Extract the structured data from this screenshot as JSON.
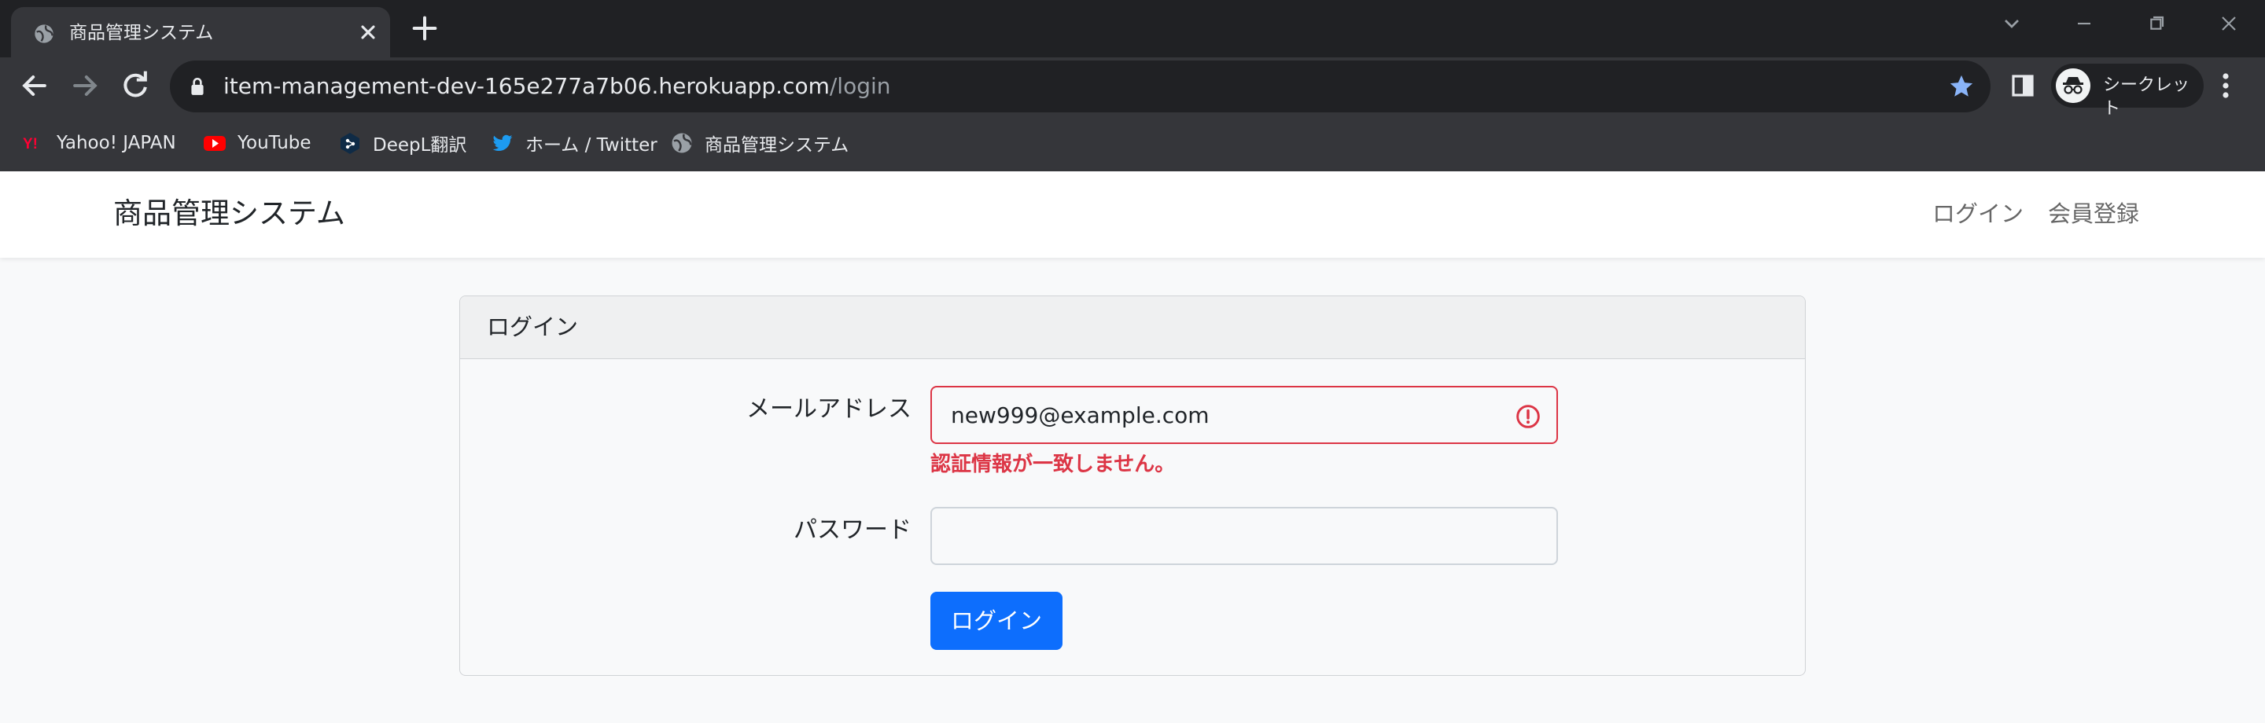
{
  "browser": {
    "tab": {
      "title": "商品管理システム",
      "favicon": "globe-icon"
    },
    "address_bar": {
      "host": "item-management-dev-165e277a7b06.herokuapp.com",
      "path": "/login"
    },
    "profile": {
      "label": "シークレット",
      "icon": "incognito-icon"
    },
    "bookmarks": [
      {
        "label": "Yahoo! JAPAN",
        "icon": "yahoo-icon"
      },
      {
        "label": "YouTube",
        "icon": "youtube-icon"
      },
      {
        "label": "DeepL翻訳",
        "icon": "deepl-icon"
      },
      {
        "label": "ホーム / Twitter",
        "icon": "twitter-icon"
      },
      {
        "label": "商品管理システム",
        "icon": "globe-icon"
      }
    ]
  },
  "navbar": {
    "brand": "商品管理システム",
    "links": [
      {
        "label": "ログイン"
      },
      {
        "label": "会員登録"
      }
    ]
  },
  "login_card": {
    "header": "ログイン",
    "email": {
      "label": "メールアドレス",
      "value": "new999@example.com",
      "error": "認証情報が一致しません。"
    },
    "password": {
      "label": "パスワード",
      "value": ""
    },
    "submit_label": "ログイン"
  },
  "colors": {
    "primary": "#0d6efd",
    "danger": "#dc3545",
    "bookmark_star": "#8ab4f8"
  }
}
